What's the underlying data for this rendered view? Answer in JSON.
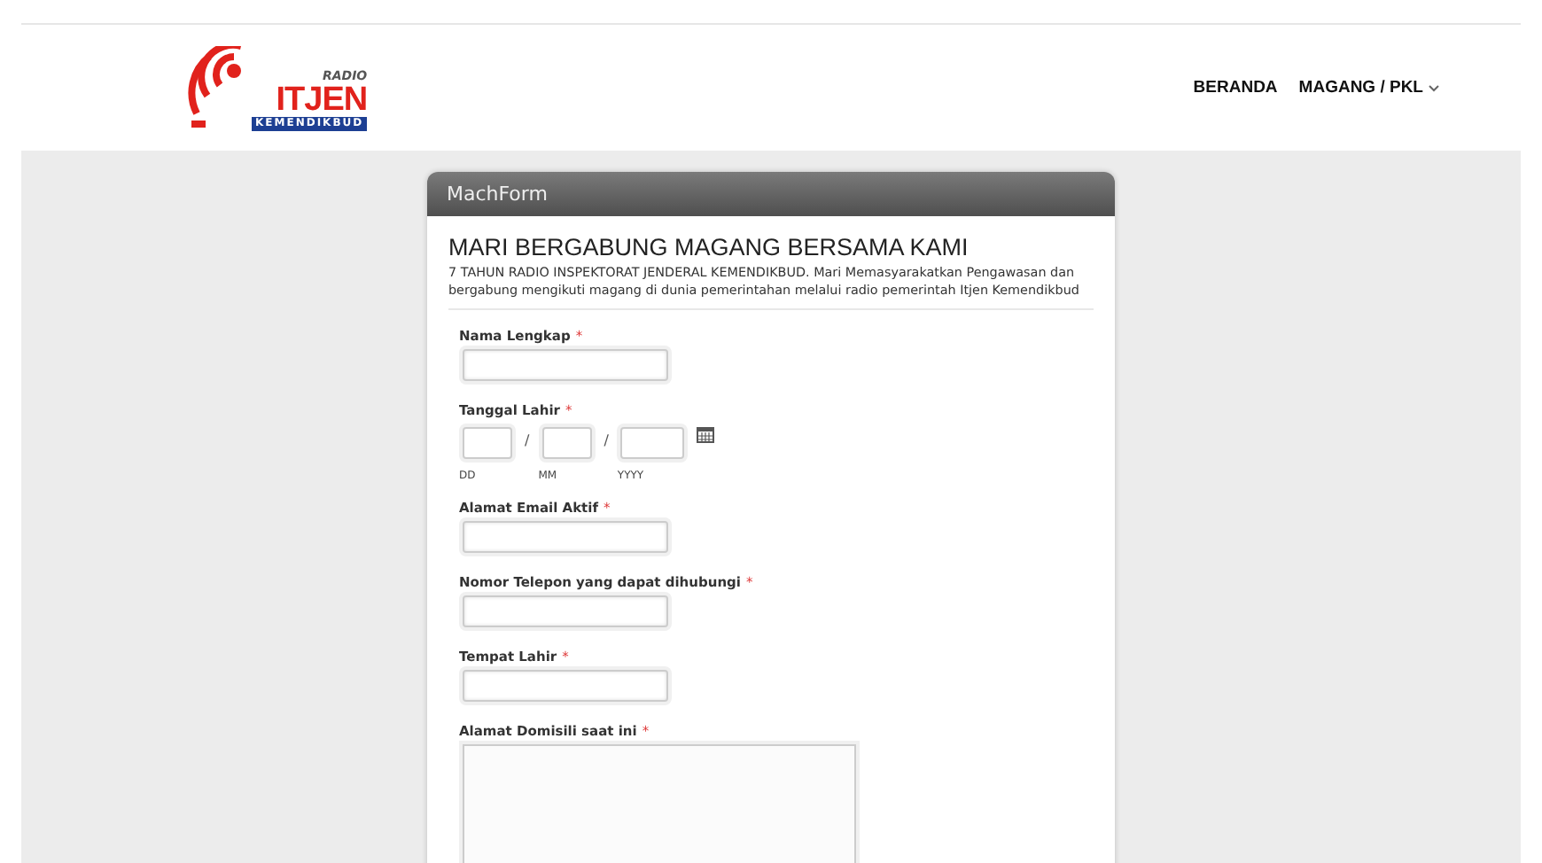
{
  "logo": {
    "top": "RADIO",
    "main": "ITJEN",
    "sub": "KEMENDIKBUD"
  },
  "nav": [
    {
      "label": "BERANDA",
      "dropdown": false
    },
    {
      "label": "MAGANG / PKL",
      "dropdown": true
    }
  ],
  "form": {
    "header": "MachForm",
    "title": "MARI BERGABUNG MAGANG BERSAMA KAMI",
    "description": "7 TAHUN RADIO INSPEKTORAT JENDERAL KEMENDIKBUD. Mari Memasyarakatkan Pengawasan dan bergabung mengikuti magang di dunia pemerintahan melalui radio pemerintah Itjen Kemendikbud",
    "fields": [
      {
        "kind": "text",
        "label": "Nama Lengkap",
        "mark": "*"
      },
      {
        "kind": "date",
        "label": "Tanggal Lahir",
        "mark": "*",
        "parts": [
          "DD",
          "MM",
          "YYYY"
        ],
        "separator": "/"
      },
      {
        "kind": "text",
        "label": "Alamat Email Aktif",
        "mark": "*"
      },
      {
        "kind": "text",
        "label": "Nomor Telepon yang dapat dihubungi",
        "mark": "*"
      },
      {
        "kind": "text",
        "label": "Tempat Lahir",
        "mark": "*"
      },
      {
        "kind": "textarea",
        "label": "Alamat Domisili saat ini",
        "mark": "*"
      }
    ]
  }
}
